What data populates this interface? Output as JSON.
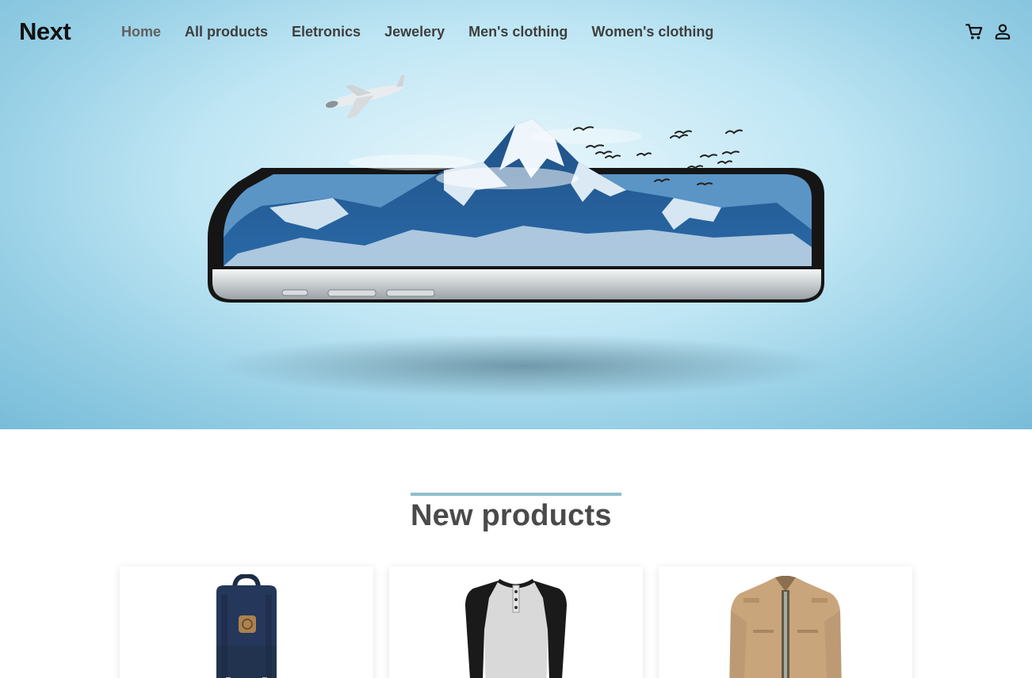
{
  "brand": {
    "name": "Next"
  },
  "nav": {
    "items": [
      {
        "label": "Home",
        "active": true
      },
      {
        "label": "All products"
      },
      {
        "label": "Eletronics"
      },
      {
        "label": "Jewelery"
      },
      {
        "label": "Men's clothing"
      },
      {
        "label": "Women's clothing"
      }
    ],
    "icons": [
      "cart-icon",
      "user-icon"
    ]
  },
  "hero": {
    "image": "floating smartphone with snowy mountain, airplane and birds"
  },
  "new_products": {
    "title": "New products",
    "items": [
      {
        "image": "navy-backpack"
      },
      {
        "image": "raglan-henley-shirt"
      },
      {
        "image": "khaki-jacket"
      }
    ]
  },
  "colors": {
    "accent_bar": "#8fbfca",
    "title_text": "#4a4a4a",
    "logo": "#111111"
  }
}
